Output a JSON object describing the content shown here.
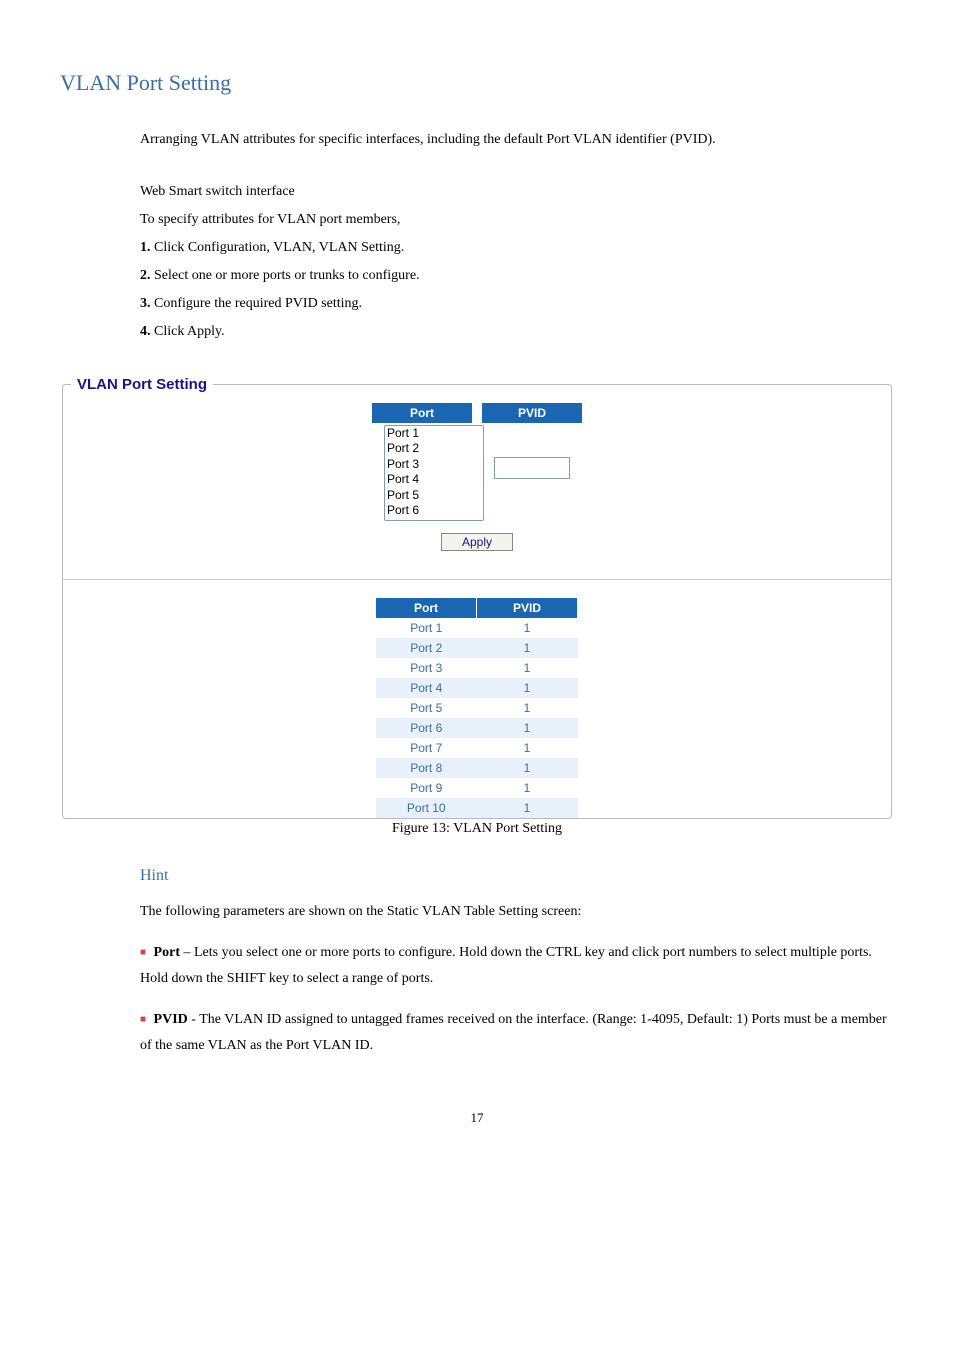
{
  "section_title": "VLAN Port Setting",
  "intro": "Arranging VLAN attributes for specific interfaces, including the default Port VLAN identifier (PVID).",
  "web_interface_line": "Web Smart switch interface",
  "specify_line": "To specify attributes for VLAN port members,",
  "steps": [
    {
      "num": "1.",
      "text": " Click Configuration, VLAN, VLAN Setting."
    },
    {
      "num": "2.",
      "text": " Select one or more ports or trunks to configure."
    },
    {
      "num": "3.",
      "text": " Configure the required PVID setting."
    },
    {
      "num": "4.",
      "text": " Click Apply."
    }
  ],
  "legend": "VLAN Port Setting",
  "form": {
    "header_port": "Port",
    "header_pvid": "PVID",
    "port_options": [
      "Port 1",
      "Port 2",
      "Port 3",
      "Port 4",
      "Port 5",
      "Port 6"
    ],
    "pvid_value": "",
    "apply_label": "Apply"
  },
  "table": {
    "header_port": "Port",
    "header_pvid": "PVID",
    "rows": [
      {
        "port": "Port 1",
        "pvid": "1"
      },
      {
        "port": "Port 2",
        "pvid": "1"
      },
      {
        "port": "Port 3",
        "pvid": "1"
      },
      {
        "port": "Port 4",
        "pvid": "1"
      },
      {
        "port": "Port 5",
        "pvid": "1"
      },
      {
        "port": "Port 6",
        "pvid": "1"
      },
      {
        "port": "Port 7",
        "pvid": "1"
      },
      {
        "port": "Port 8",
        "pvid": "1"
      },
      {
        "port": "Port 9",
        "pvid": "1"
      },
      {
        "port": "Port 10",
        "pvid": "1"
      }
    ]
  },
  "figure_caption": "Figure 13: VLAN Port Setting",
  "hint": {
    "heading": "Hint",
    "intro": "The following parameters are shown on the Static VLAN Table Setting screen:",
    "items": [
      {
        "bold": "Port",
        "sep": " – ",
        "text": "Lets you select one or more ports to configure. Hold down the CTRL key and click port numbers to select multiple ports. Hold down the SHIFT key to select a range of ports."
      },
      {
        "bold": "PVID",
        "sep": " - ",
        "text": "The VLAN ID assigned to untagged frames received on the interface. (Range: 1-4095, Default: 1) Ports must be a member of the same VLAN as the Port VLAN ID."
      }
    ]
  },
  "page_number": "17"
}
